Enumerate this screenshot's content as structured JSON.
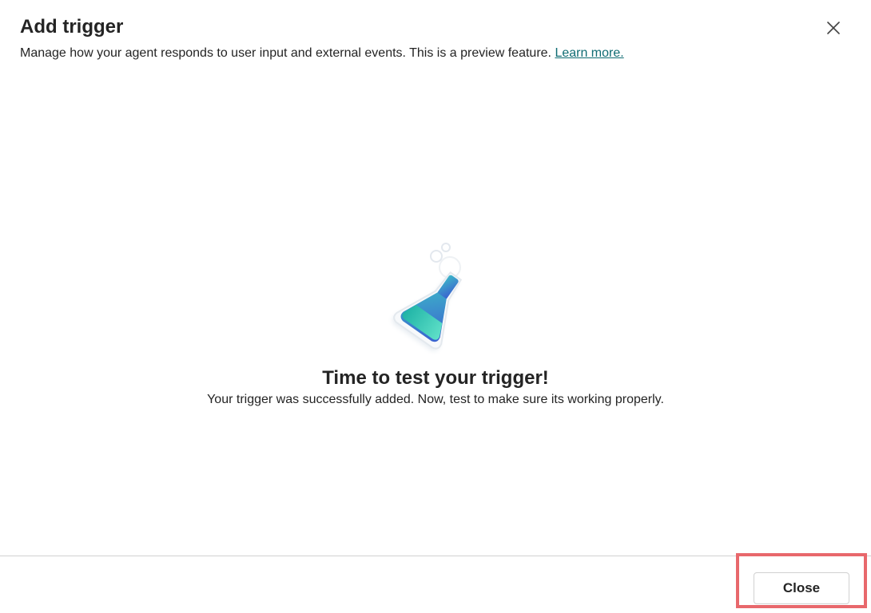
{
  "dialog": {
    "title": "Add trigger",
    "subtitle": "Manage how your agent responds to user input and external events. This is a preview feature.",
    "learn_more": "Learn more.",
    "close_icon": "close-icon"
  },
  "empty_state": {
    "illustration": "flask-icon",
    "title": "Time to test your trigger!",
    "description": "Your trigger was successfully added. Now, test to make sure its working properly."
  },
  "footer": {
    "close_label": "Close"
  },
  "colors": {
    "link": "#0f6c73",
    "highlight": "#e8686c",
    "flask_teal": "#2ec4b6",
    "flask_blue": "#3a6fd8"
  }
}
